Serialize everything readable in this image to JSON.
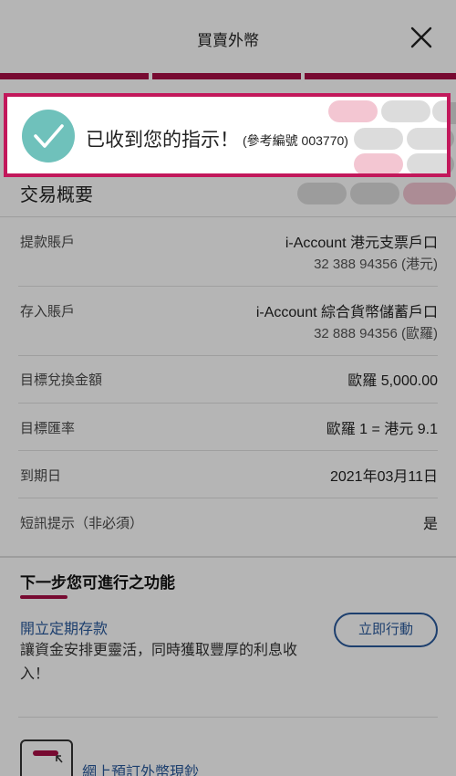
{
  "header": {
    "title": "買賣外幣"
  },
  "toast": {
    "message": "已收到您的指示！",
    "reference": "(參考編號 003770)"
  },
  "summary": {
    "title": "交易概要",
    "rows": [
      {
        "label": "提款賬戶",
        "value": "i-Account 港元支票戶口",
        "sub": "32 388 94356 (港元)"
      },
      {
        "label": "存入賬戶",
        "value": "i-Account 綜合貨幣儲蓄戶口",
        "sub": "32 888 94356 (歐羅)"
      },
      {
        "label": "目標兌換金額",
        "value": "歐羅 5,000.00"
      },
      {
        "label": "目標匯率",
        "value": "歐羅 1 = 港元 9.1"
      },
      {
        "label": "到期日",
        "value": "2021年03月11日"
      },
      {
        "label": "短訊提示（非必須）",
        "value": "是"
      }
    ]
  },
  "next_steps": {
    "title": "下一步您可進行之功能",
    "items": [
      {
        "link": "開立定期存款",
        "description": "讓資金安排更靈活，同時獲取豐厚的利息收入！",
        "button": "立即行動"
      },
      {
        "link": "網上預訂外幣現鈔"
      }
    ]
  },
  "colors": {
    "accent": "#a80f46",
    "link": "#2a5a9c",
    "success": "#6fc1bb",
    "highlight_border": "#c2185b"
  }
}
